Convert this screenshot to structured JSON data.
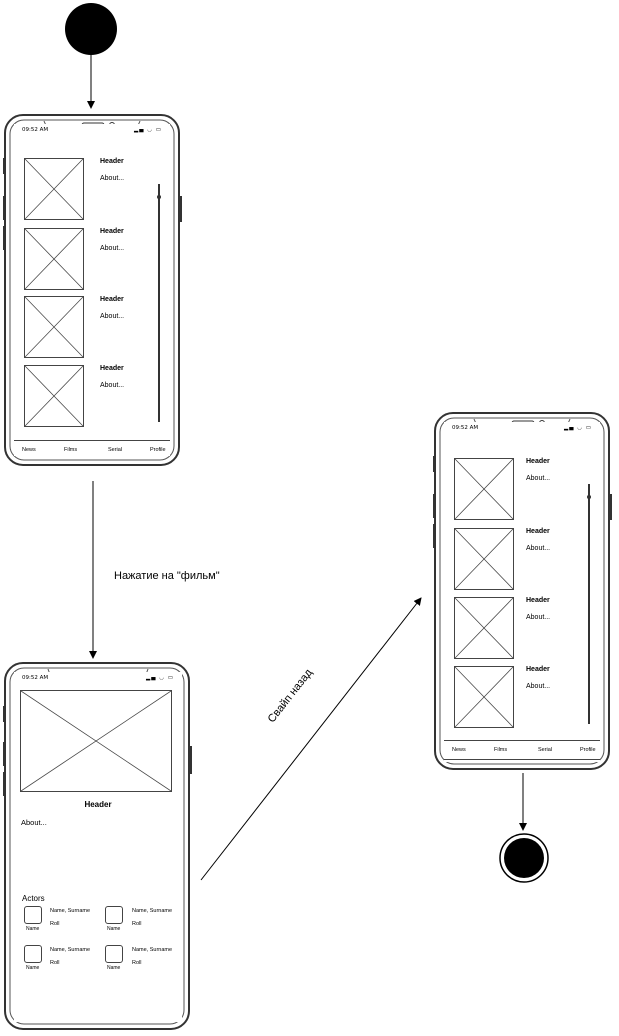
{
  "diagram": {
    "edges": {
      "tap_film_label": "Нажатие на \"фильм\"",
      "swipe_back_label": "Свайп назад"
    },
    "list_screen": {
      "status_time": "09:52 AM",
      "status_icons": "▂▄ ◡ ▭",
      "items": [
        {
          "header": "Header",
          "about": "About..."
        },
        {
          "header": "Header",
          "about": "About..."
        },
        {
          "header": "Header",
          "about": "About..."
        },
        {
          "header": "Header",
          "about": "About..."
        }
      ],
      "nav": [
        "News",
        "Films",
        "Serial",
        "Profile"
      ]
    },
    "detail_screen": {
      "status_time": "09:52 AM",
      "status_icons": "▂▄ ◡ ▭",
      "header": "Header",
      "about": "About...",
      "actors_title": "Actors",
      "actors": [
        {
          "name": "Name, Surname",
          "roll": "Roll",
          "caption": "Name"
        },
        {
          "name": "Name, Surname",
          "roll": "Roll",
          "caption": "Name"
        },
        {
          "name": "Name, Surname",
          "roll": "Roll",
          "caption": "Name"
        },
        {
          "name": "Name, Surname",
          "roll": "Roll",
          "caption": "Name"
        }
      ]
    }
  }
}
